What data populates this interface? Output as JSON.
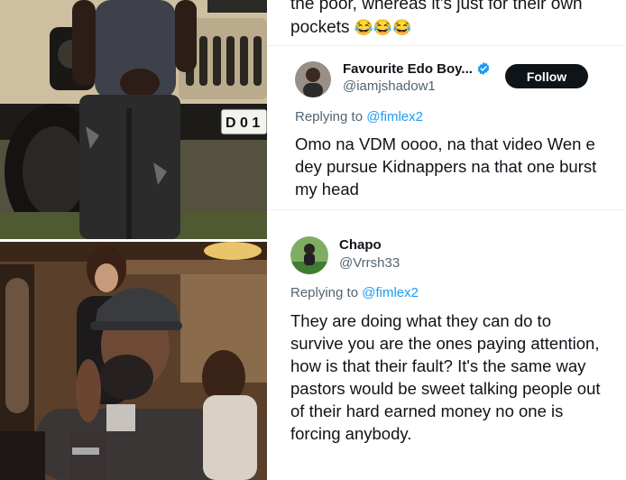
{
  "top_tweet": {
    "partial_line": "the poor, whereas it's just for their own",
    "last_line": "pockets",
    "emoji": "😂😂😂"
  },
  "replies": [
    {
      "display_name": "Favourite Edo Boy...",
      "handle": "@iamjshadow1",
      "verified": true,
      "follow_label": "Follow",
      "replying_prefix": "Replying to",
      "replying_to": "@fimlex2",
      "text": "Omo na VDM oooo, na that video Wen e dey pursue Kidnappers na that one burst my head"
    },
    {
      "display_name": "Chapo",
      "handle": "@Vrrsh33",
      "verified": false,
      "replying_prefix": "Replying to",
      "replying_to": "@fimlex2",
      "text": "They are doing what they can do to survive you are the ones paying attention, how is that their fault? It's the same way pastors would be sweet talking people out of their hard earned money no one is forcing anybody."
    }
  ],
  "photo_top": {
    "plate_text": "D 0 1"
  },
  "colors": {
    "accent": "#1d9bf0",
    "follow_bg": "#0f1419",
    "muted": "#536471"
  }
}
